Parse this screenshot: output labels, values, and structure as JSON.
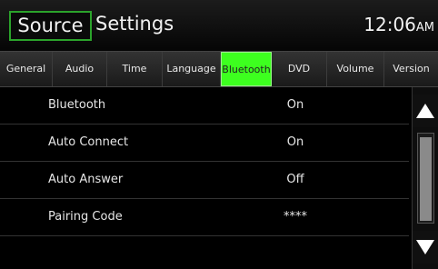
{
  "header": {
    "source_label": "Source",
    "title": "Settings",
    "time": "12:06",
    "ampm": "AM"
  },
  "tabs": [
    {
      "label": "General",
      "active": false
    },
    {
      "label": "Audio",
      "active": false
    },
    {
      "label": "Time",
      "active": false
    },
    {
      "label": "Language",
      "active": false
    },
    {
      "label": "Bluetooth",
      "active": true
    },
    {
      "label": "DVD",
      "active": false
    },
    {
      "label": "Volume",
      "active": false
    },
    {
      "label": "Version",
      "active": false
    }
  ],
  "rows": [
    {
      "label": "Bluetooth",
      "value": "On"
    },
    {
      "label": "Auto Connect",
      "value": "On"
    },
    {
      "label": "Auto Answer",
      "value": "Off"
    },
    {
      "label": "Pairing Code",
      "value": "****"
    },
    {
      "label": "",
      "value": ""
    }
  ],
  "colors": {
    "active_tab": "#3dff1f",
    "source_border": "#2ba32b"
  },
  "icons": {
    "scroll_up": "triangle-up-icon",
    "scroll_down": "triangle-down-icon"
  }
}
